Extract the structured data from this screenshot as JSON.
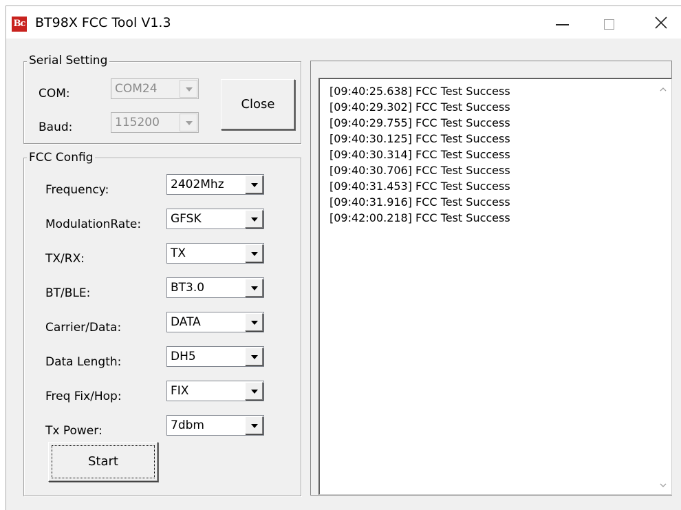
{
  "window": {
    "title": "BT98X FCC Tool V1.3",
    "icon_text": "Bc",
    "icon_name": "app-logo-icon",
    "controls": [
      "minimize-icon",
      "maximize-icon",
      "close-icon"
    ]
  },
  "serial": {
    "group_title": "Serial Setting",
    "com_label": "COM:",
    "com_value": "COM24",
    "baud_label": "Baud:",
    "baud_value": "115200",
    "close_button": "Close"
  },
  "fcc": {
    "group_title": "FCC Config",
    "fields": [
      {
        "label": "Frequency:",
        "value": "2402Mhz"
      },
      {
        "label": "ModulationRate:",
        "value": "GFSK"
      },
      {
        "label": "TX/RX:",
        "value": "TX"
      },
      {
        "label": "BT/BLE:",
        "value": "BT3.0"
      },
      {
        "label": "Carrier/Data:",
        "value": "DATA"
      },
      {
        "label": "Data Length:",
        "value": "DH5"
      },
      {
        "label": "Freq Fix/Hop:",
        "value": "FIX"
      },
      {
        "label": "Tx Power:",
        "value": "7dbm"
      }
    ],
    "start_button": "Start"
  },
  "log": {
    "lines": [
      "[09:40:25.638] FCC Test Success",
      "[09:40:29.302] FCC Test Success",
      "[09:40:29.755] FCC Test Success",
      "[09:40:30.125] FCC Test Success",
      "[09:40:30.314] FCC Test Success",
      "[09:40:30.706] FCC Test Success",
      "[09:40:31.453] FCC Test Success",
      "[09:40:31.916] FCC Test Success",
      "[09:42:00.218] FCC Test Success"
    ]
  },
  "colors": {
    "window_bg": "#f0f0f0",
    "icon_bg": "#c8221e"
  }
}
